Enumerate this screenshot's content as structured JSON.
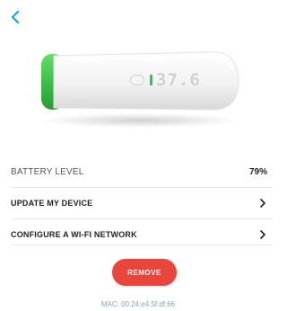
{
  "header": {
    "back_icon": "chevron-left-icon",
    "accent_color": "#1aa3e8"
  },
  "device": {
    "display_reading": "37.6",
    "indicator_color": "#2fc25a",
    "cap_color": "#3cc04a"
  },
  "battery": {
    "label": "BATTERY LEVEL",
    "value": "79%"
  },
  "actions": [
    {
      "label": "UPDATE MY DEVICE",
      "icon": "chevron-right-icon"
    },
    {
      "label": "CONFIGURE A WI-FI NETWORK",
      "icon": "chevron-right-icon"
    }
  ],
  "remove_button": {
    "label": "REMOVE",
    "color": "#e8453c"
  },
  "mac": {
    "text": "MAC: 00:24:e4:5f:df:66"
  }
}
